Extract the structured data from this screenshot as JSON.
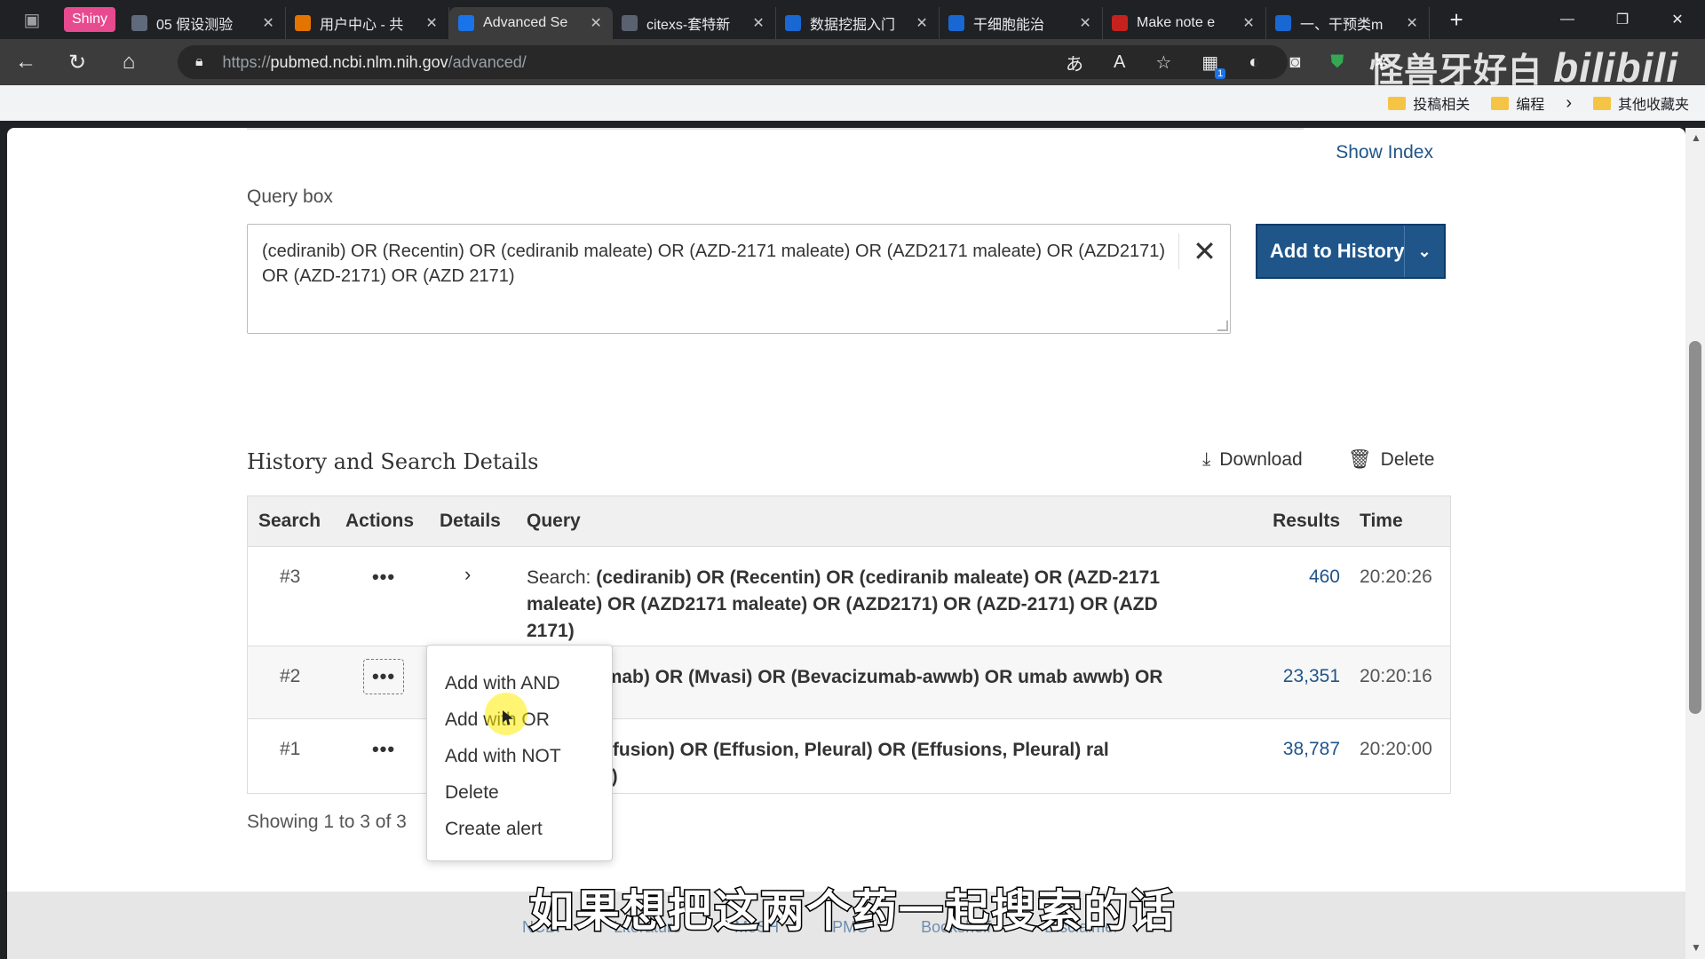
{
  "browser": {
    "tabs": [
      {
        "label": "Shiny",
        "type": "pill"
      },
      {
        "label": "05 假设测验",
        "color": "#5f6a7a"
      },
      {
        "label": "用户中心 - 共",
        "color": "#e37400"
      },
      {
        "label": "Advanced Se",
        "color": "#1a73e8",
        "active": true
      },
      {
        "label": "citexs-套特新",
        "color": "#5a6270"
      },
      {
        "label": "数据挖掘入门",
        "color": "#1967d2"
      },
      {
        "label": "干细胞能治",
        "color": "#1967d2"
      },
      {
        "label": "Make note e",
        "color": "#c5221f"
      },
      {
        "label": "一、干预类m",
        "color": "#1967d2"
      }
    ],
    "url_prefix": "https://",
    "url_host": "pubmed.ncbi.nlm.nih.gov",
    "url_path": "/advanced/",
    "bookmarks": [
      "投稿相关",
      "编程",
      "其他收藏夹"
    ],
    "watermark": "怪兽牙好白",
    "watermark_logo": "bilibili"
  },
  "page": {
    "show_index": "Show Index",
    "query_box_label": "Query box",
    "query_box_value": "(cediranib) OR (Recentin) OR (cediranib maleate) OR (AZD-2171 maleate) OR (AZD2171 maleate) OR (AZD2171) OR (AZD-2171) OR (AZD 2171)",
    "add_to_history": "Add to History",
    "history_title": "History and Search Details",
    "download": "Download",
    "delete": "Delete",
    "table": {
      "headers": [
        "Search",
        "Actions",
        "Details",
        "Query",
        "Results",
        "Time"
      ],
      "rows": [
        {
          "num": "#3",
          "prefix": "Search: ",
          "query": "(cediranib) OR (Recentin) OR (cediranib maleate) OR (AZD-2171 maleate) OR (AZD2171 maleate) OR (AZD2171) OR (AZD-2171) OR (AZD 2171)",
          "results": "460",
          "time": "20:20:26"
        },
        {
          "num": "#2",
          "prefix": "",
          "query": "bevacizumab) OR (Mvasi) OR (Bevacizumab-awwb) OR umab awwb) OR (Avastin)",
          "results": "23,351",
          "time": "20:20:16"
        },
        {
          "num": "#1",
          "prefix": "",
          "query": "Pleural Effusion) OR (Effusion, Pleural) OR (Effusions, Pleural) ral Effusions)",
          "results": "38,787",
          "time": "20:20:00"
        }
      ]
    },
    "showing": "Showing 1 to 3 of 3",
    "menu": [
      "Add with AND",
      "Add with OR",
      "Add with NOT",
      "Delete",
      "Create alert"
    ],
    "footer_links": [
      "NCBI",
      "Literature",
      "MeSH",
      "PMC",
      "Bookshelf",
      "Disclaimer"
    ]
  },
  "subtitle": "如果想把这两个药一起搜索的话",
  "colors": {
    "link": "#20558a",
    "button": "#20558a",
    "highlight": "#ffec00"
  }
}
